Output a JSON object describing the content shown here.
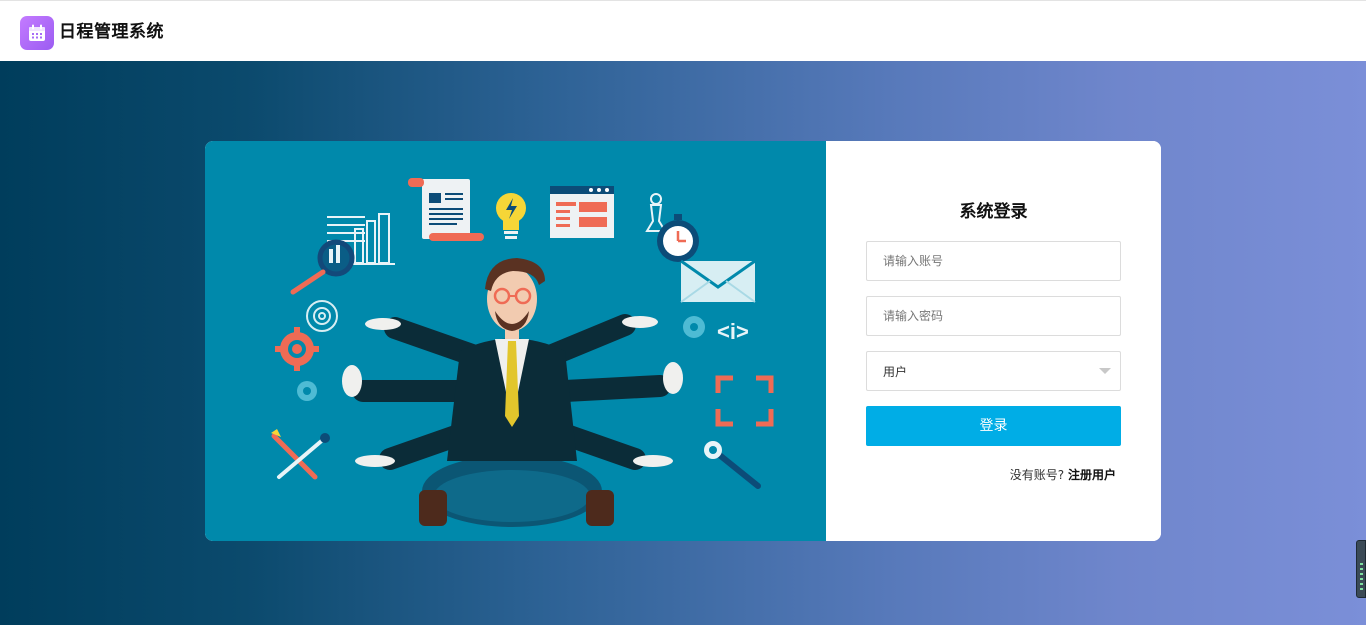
{
  "header": {
    "app_title": "日程管理系统",
    "logo_icon": "calendar-icon",
    "logo_color": "#a76cf7"
  },
  "login": {
    "title": "系统登录",
    "account_placeholder": "请输入账号",
    "password_placeholder": "请输入密码",
    "role_selected": "用户",
    "submit_label": "登录",
    "no_account_text": "没有账号?",
    "register_label": "注册用户"
  },
  "illustration": {
    "description_icon": "multitasking-businessman-illustration",
    "background_color": "#0089ab"
  },
  "colors": {
    "primary_button": "#00ade6",
    "gradient_start": "#003d5c",
    "gradient_end": "#7b8fd8"
  }
}
